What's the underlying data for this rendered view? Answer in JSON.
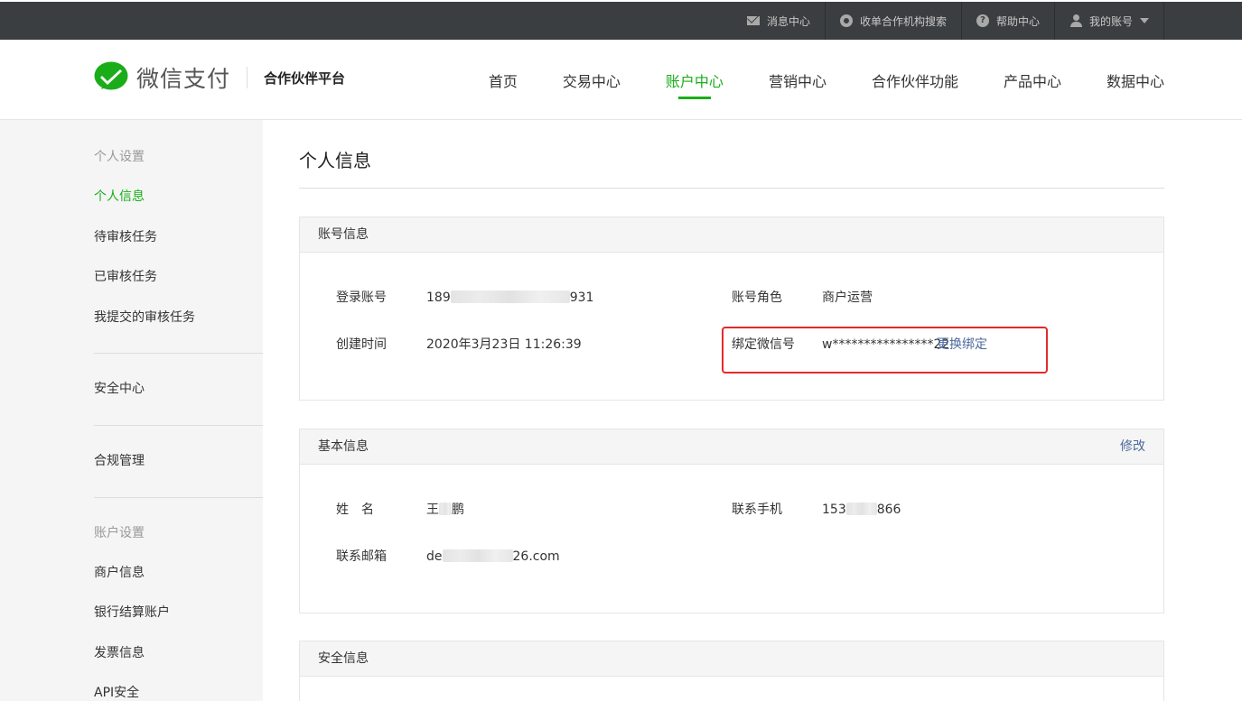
{
  "topbar": {
    "items": [
      {
        "label": "消息中心",
        "icon": "mail-icon"
      },
      {
        "label": "收单合作机构搜索",
        "icon": "search-icon"
      },
      {
        "label": "帮助中心",
        "icon": "help-icon"
      },
      {
        "label": "我的账号",
        "icon": "user-icon"
      }
    ]
  },
  "header": {
    "brand": "微信支付",
    "subtitle": "合作伙伴平台",
    "brand_color": "#1aad19",
    "nav": [
      {
        "label": "首页"
      },
      {
        "label": "交易中心"
      },
      {
        "label": "账户中心",
        "active": true
      },
      {
        "label": "营销中心"
      },
      {
        "label": "合作伙伴功能"
      },
      {
        "label": "产品中心"
      },
      {
        "label": "数据中心"
      }
    ]
  },
  "sidebar": {
    "group1_title": "个人设置",
    "group1_items": [
      "个人信息",
      "待审核任务",
      "已审核任务",
      "我提交的审核任务"
    ],
    "security": "安全中心",
    "compliance": "合规管理",
    "group2_title": "账户设置",
    "group2_items": [
      "商户信息",
      "银行结算账户",
      "发票信息",
      "API安全"
    ]
  },
  "main": {
    "title": "个人信息",
    "account": {
      "heading": "账号信息",
      "login_label": "登录账号",
      "login_value_prefix": "189",
      "login_value_suffix": "931",
      "created_label": "创建时间",
      "created_value": "2020年3月23日 11:26:39",
      "role_label": "账号角色",
      "role_value": "商户运营",
      "wechat_label": "绑定微信号",
      "wechat_value": "w****************22",
      "rebind_label": "更换绑定"
    },
    "basic": {
      "heading": "基本信息",
      "edit_label": "修改",
      "name_label": "姓　名",
      "name_prefix": "王",
      "name_suffix": "鹏",
      "phone_label": "联系手机",
      "phone_prefix": "153",
      "phone_suffix": "866",
      "email_label": "联系邮箱",
      "email_prefix": "de",
      "email_suffix": "26.com"
    },
    "security": {
      "heading": "安全信息"
    }
  }
}
